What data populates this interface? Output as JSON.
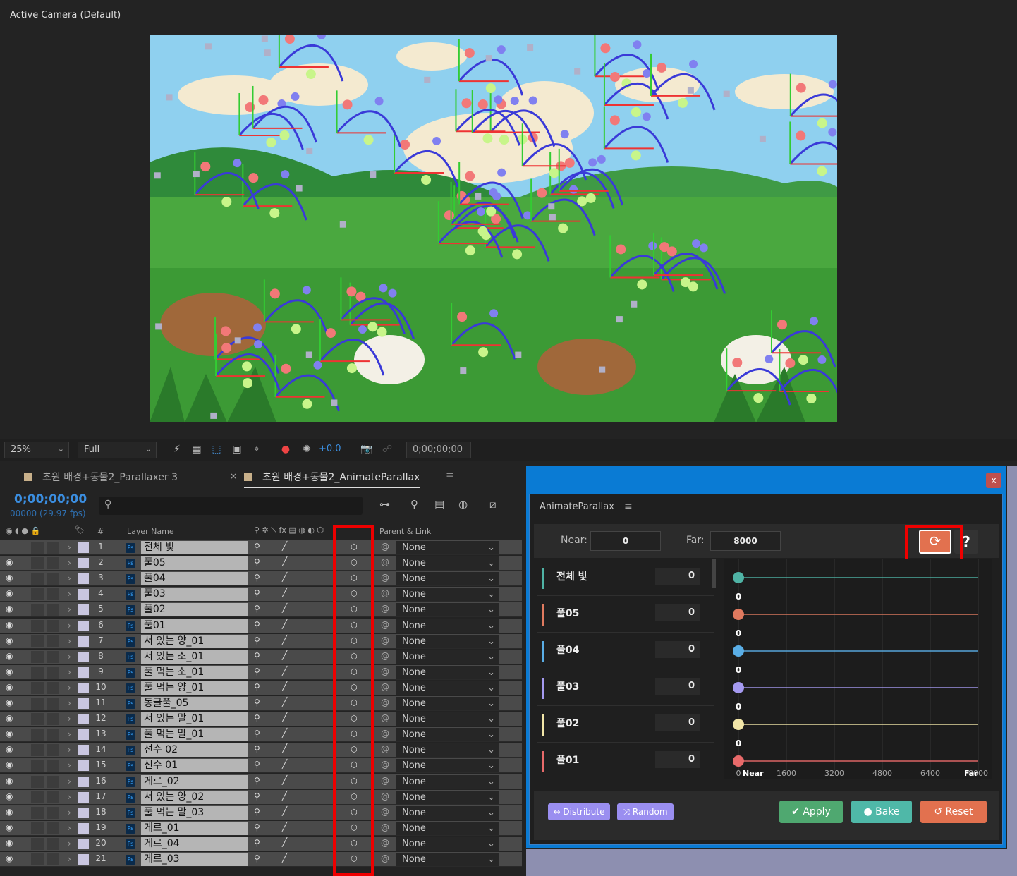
{
  "viewer": {
    "title": "Active Camera (Default)"
  },
  "toolbar": {
    "zoom": "25%",
    "resolution": "Full",
    "exposure": "+0.0",
    "timecode": "0;00;00;00"
  },
  "tabs": [
    {
      "label": "초원 배경+동물2_Parallaxer 3",
      "active": false
    },
    {
      "label": "초원 배경+동물2_AnimateParallax",
      "active": true
    }
  ],
  "timeline": {
    "timecode": "0;00;00;00",
    "frames": "00000 (29.97 fps)",
    "search_placeholder": "",
    "headers": {
      "num": "#",
      "layer_name": "Layer Name",
      "parent": "Parent & Link"
    },
    "layers": [
      {
        "num": "1",
        "name": "전체 빛",
        "parent": "None"
      },
      {
        "num": "2",
        "name": "풀05",
        "parent": "None"
      },
      {
        "num": "3",
        "name": "풀04",
        "parent": "None"
      },
      {
        "num": "4",
        "name": "풀03",
        "parent": "None"
      },
      {
        "num": "5",
        "name": "풀02",
        "parent": "None"
      },
      {
        "num": "6",
        "name": "풀01",
        "parent": "None"
      },
      {
        "num": "7",
        "name": "서 있는 양_01",
        "parent": "None"
      },
      {
        "num": "8",
        "name": "서 있는 소_01",
        "parent": "None"
      },
      {
        "num": "9",
        "name": "풀 먹는 소_01",
        "parent": "None"
      },
      {
        "num": "10",
        "name": "풀 먹는 양_01",
        "parent": "None"
      },
      {
        "num": "11",
        "name": "동글풀_05",
        "parent": "None"
      },
      {
        "num": "12",
        "name": "서 있는 말_01",
        "parent": "None"
      },
      {
        "num": "13",
        "name": "풀 먹는 말_01",
        "parent": "None"
      },
      {
        "num": "14",
        "name": "선수 02",
        "parent": "None"
      },
      {
        "num": "15",
        "name": "선수 01",
        "parent": "None"
      },
      {
        "num": "16",
        "name": "게르_02",
        "parent": "None"
      },
      {
        "num": "17",
        "name": "서 있는 양_02",
        "parent": "None"
      },
      {
        "num": "18",
        "name": "풀 먹는 말_03",
        "parent": "None"
      },
      {
        "num": "19",
        "name": "게르_01",
        "parent": "None"
      },
      {
        "num": "20",
        "name": "게르_04",
        "parent": "None"
      },
      {
        "num": "21",
        "name": "게르_03",
        "parent": "None"
      }
    ]
  },
  "plugin": {
    "close": "x",
    "title": "AnimateParallax",
    "near_label": "Near:",
    "near": "0",
    "far_label": "Far:",
    "far": "8000",
    "help": "?",
    "layers": [
      {
        "name": "전체 빛",
        "value": "0",
        "color": "#4fb3a5"
      },
      {
        "name": "풀05",
        "value": "0",
        "color": "#e07a5f"
      },
      {
        "name": "풀04",
        "value": "0",
        "color": "#5aaee6"
      },
      {
        "name": "풀03",
        "value": "0",
        "color": "#a59af0"
      },
      {
        "name": "풀02",
        "value": "0",
        "color": "#f2e6a8"
      },
      {
        "name": "풀01",
        "value": "0",
        "color": "#e86a6a"
      }
    ],
    "axis": {
      "ticks": [
        "0",
        "1600",
        "3200",
        "4800",
        "6400",
        "8000"
      ],
      "near_label": "Near",
      "far_label": "Far",
      "range": [
        0,
        8000
      ]
    },
    "buttons": {
      "distribute": "↔ Distribute",
      "random": "⤨ Random",
      "apply": "Apply",
      "bake": "Bake",
      "reset": "Reset"
    },
    "colors": {
      "distribute": "#9a8ef0",
      "apply": "#4fa870",
      "bake": "#4fb8a8",
      "reset": "#e2714f",
      "refresh": "#e2714f"
    }
  }
}
